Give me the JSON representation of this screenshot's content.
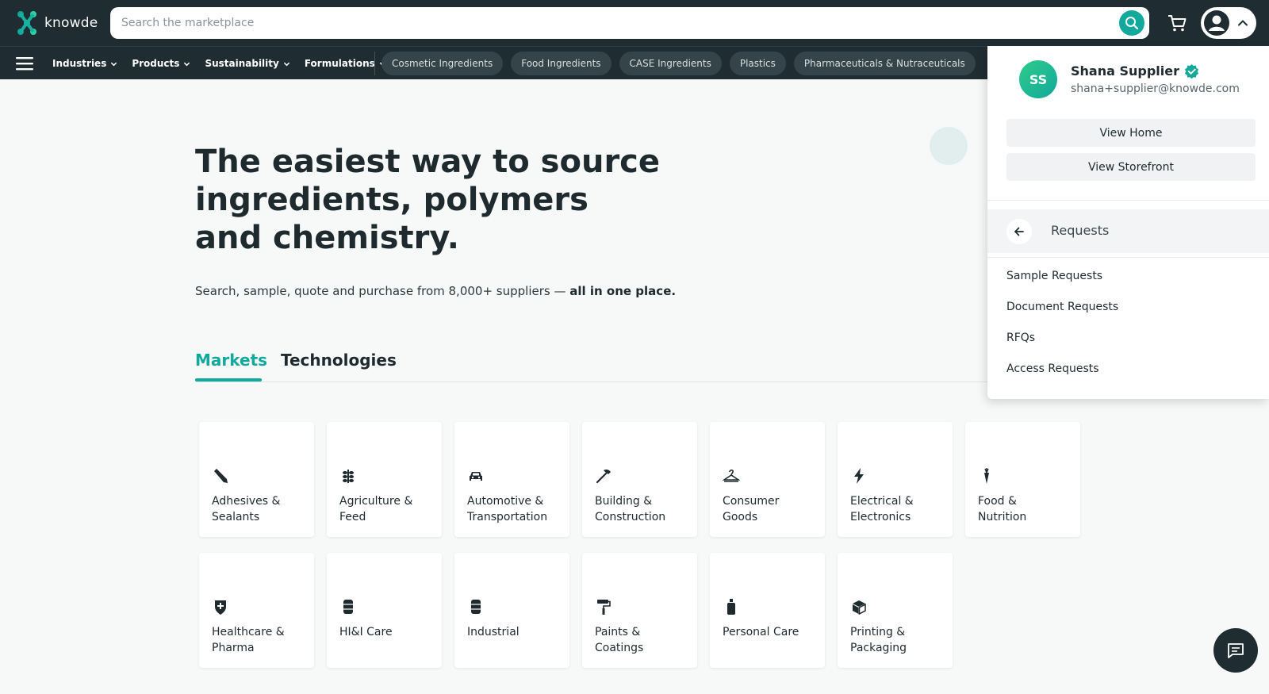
{
  "brand": {
    "name": "knowde"
  },
  "search": {
    "placeholder": "Search the marketplace"
  },
  "nav": {
    "menu": [
      {
        "label": "Industries"
      },
      {
        "label": "Products"
      },
      {
        "label": "Sustainability"
      },
      {
        "label": "Formulations"
      }
    ],
    "chips": [
      {
        "label": "Cosmetic Ingredients"
      },
      {
        "label": "Food Ingredients"
      },
      {
        "label": "CASE Ingredients"
      },
      {
        "label": "Plastics"
      },
      {
        "label": "Pharmaceuticals & Nutraceuticals"
      }
    ]
  },
  "hero": {
    "title_line1": "The easiest way to source",
    "title_line2": "ingredients, polymers",
    "title_line3": "and chemistry.",
    "subtitle": "Search, sample, quote and purchase from 8,000+ suppliers —",
    "subtitle_bold": "all in one place."
  },
  "tabs": {
    "markets": "Markets",
    "technologies": "Technologies"
  },
  "markets": [
    {
      "line1": "Adhesives &",
      "line2": "Sealants",
      "icon": "pen-icon"
    },
    {
      "line1": "Agriculture &",
      "line2": "Feed",
      "icon": "wheat-icon"
    },
    {
      "line1": "Automotive &",
      "line2": "Transportation",
      "icon": "car-icon"
    },
    {
      "line1": "Building &",
      "line2": "Construction",
      "icon": "hammer-icon"
    },
    {
      "line1": "Consumer",
      "line2": "Goods",
      "icon": "hanger-icon"
    },
    {
      "line1": "Electrical &",
      "line2": "Electronics",
      "icon": "bolt-icon"
    },
    {
      "line1": "Food &",
      "line2": "Nutrition",
      "icon": "carrot-icon"
    },
    {
      "line1": "Healthcare &",
      "line2": "Pharma",
      "icon": "shield-cross-icon"
    },
    {
      "line1": "HI&I Care",
      "line2": "",
      "icon": "barrel-icon"
    },
    {
      "line1": "Industrial",
      "line2": "",
      "icon": "drum-icon"
    },
    {
      "line1": "Paints &",
      "line2": "Coatings",
      "icon": "paint-roller-icon"
    },
    {
      "line1": "Personal Care",
      "line2": "",
      "icon": "bottle-icon"
    },
    {
      "line1": "Printing &",
      "line2": "Packaging",
      "icon": "box-icon"
    }
  ],
  "account": {
    "initials": "SS",
    "name": "Shana Supplier",
    "email": "shana+supplier@knowde.com",
    "view_home": "View Home",
    "view_storefront": "View Storefront",
    "section_title": "Requests",
    "links": [
      {
        "label": "Sample Requests"
      },
      {
        "label": "Document Requests"
      },
      {
        "label": "RFQs"
      },
      {
        "label": "Access Requests"
      }
    ]
  },
  "colors": {
    "accent": "#12a89b",
    "header_bg": "#1f2d33",
    "chip_bg": "#35444a"
  }
}
